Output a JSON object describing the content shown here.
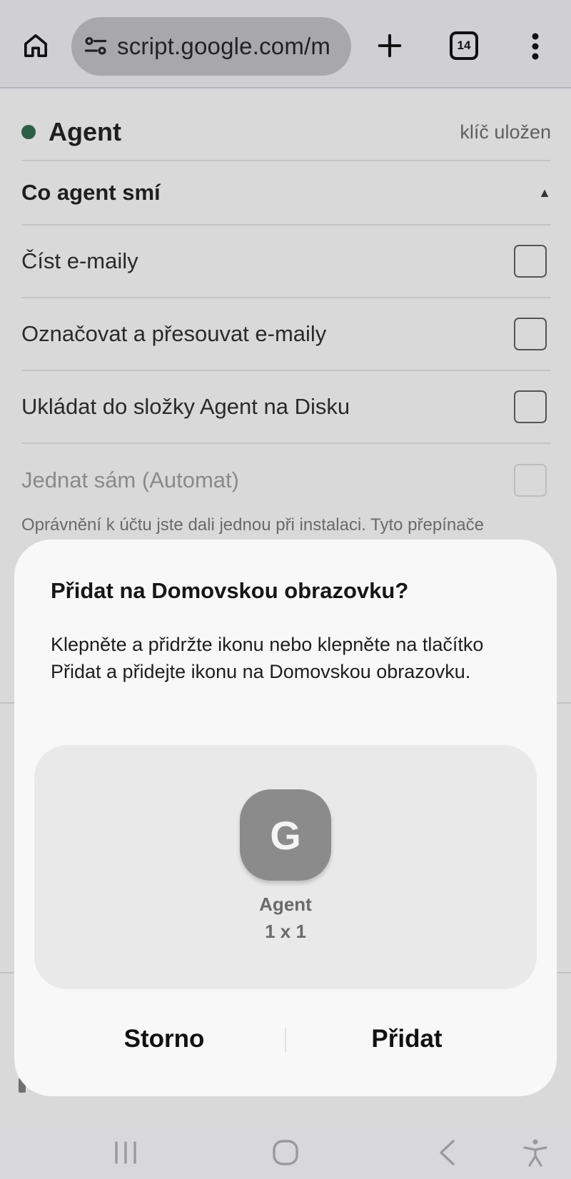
{
  "browser": {
    "url": "script.google.com/m",
    "tab_count": "14"
  },
  "page": {
    "agent_title": "Agent",
    "key_status": "klíč uložen",
    "permissions_title": "Co agent smí",
    "permissions": [
      {
        "label": "Číst e-maily",
        "checked": false,
        "enabled": true
      },
      {
        "label": "Označovat a přesouvat e-maily",
        "checked": false,
        "enabled": true
      },
      {
        "label": "Ukládat do složky Agent na Disku",
        "checked": false,
        "enabled": true
      },
      {
        "label": "Jednat sám (Automat)",
        "checked": false,
        "enabled": false
      }
    ],
    "note": "Oprávnění k účtu jste dali jednou při instalaci. Tyto přepínače"
  },
  "dialog": {
    "title": "Přidat na Domovskou obrazovku?",
    "body": "Klepněte a přidržte ikonu nebo klepněte na tlačítko Přidat a přidejte ikonu na Domovskou obrazovku.",
    "icon_letter": "G",
    "app_name": "Agent",
    "widget_size": "1 x 1",
    "cancel_label": "Storno",
    "add_label": "Přidat"
  },
  "colors": {
    "status_dot": "#2c5f45",
    "app_icon": "#8b8b8b"
  },
  "icons": [
    "home-icon",
    "site-settings-icon",
    "plus-icon",
    "tab-switcher-icon",
    "more-vert-icon",
    "recents-icon",
    "home-nav-icon",
    "back-icon",
    "accessibility-icon"
  ]
}
